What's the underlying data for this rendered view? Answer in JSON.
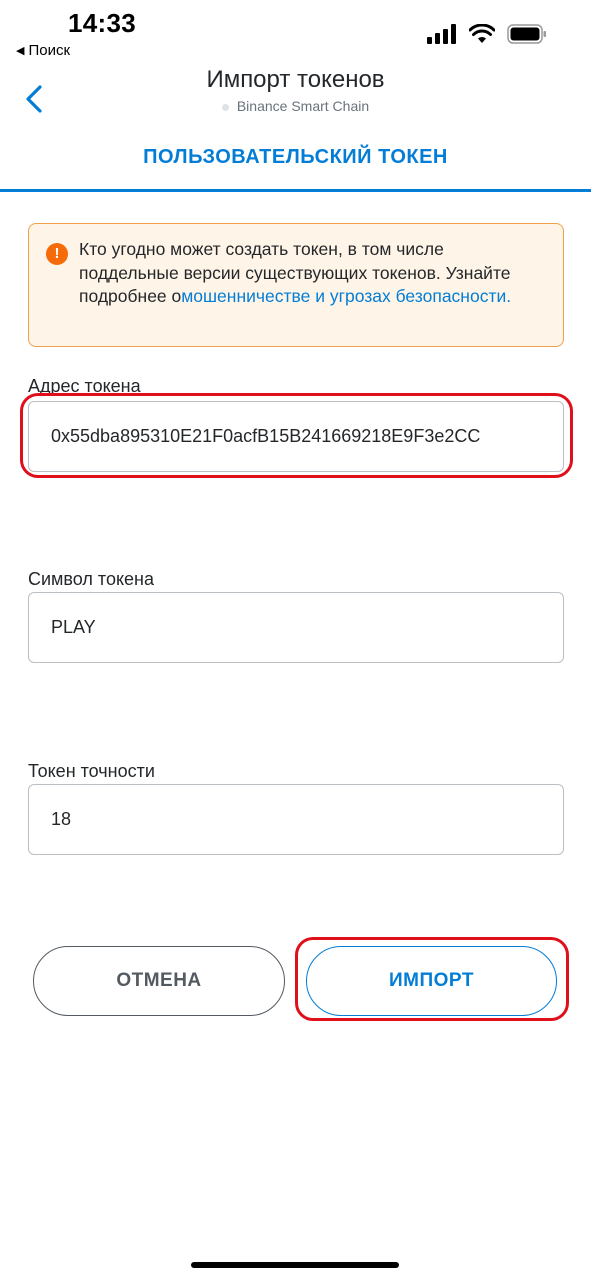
{
  "status_bar": {
    "time": "14:33",
    "back_app_label": "Поиск",
    "icons": [
      "cellular-signal-icon",
      "wifi-icon",
      "battery-icon"
    ]
  },
  "header": {
    "back_icon": "chevron-left-icon",
    "title": "Импорт токенов",
    "network": "Binance Smart Chain"
  },
  "tab": {
    "label": "ПОЛЬЗОВАТЕЛЬСКИЙ ТОКЕН"
  },
  "warning": {
    "icon": "exclamation-icon",
    "text_before": "Кто угодно может создать токен, в том числе поддельные версии существующих токенов. Узнайте подробнее о",
    "link_text": "мошенничестве и угрозах безопасности.",
    "link_color": "#037dd6",
    "border_color": "#f0a14a"
  },
  "form": {
    "address": {
      "label": "Адрес токена",
      "value": "0x55dba895310E21F0acfB15B241669218E9F3e2CC"
    },
    "symbol": {
      "label": "Символ токена",
      "value": "PLAY"
    },
    "decimals": {
      "label": "Токен точности",
      "value": "18"
    }
  },
  "buttons": {
    "cancel_label": "ОТМЕНА",
    "import_label": "ИМПОРТ"
  },
  "colors": {
    "accent": "#037dd6",
    "highlight": "#e0101a"
  }
}
